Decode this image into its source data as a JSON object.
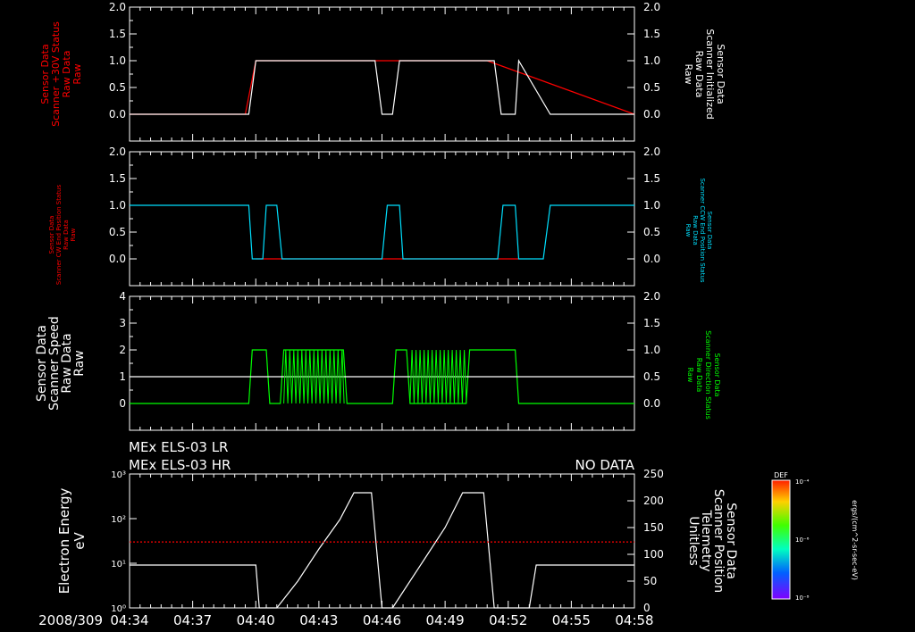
{
  "header": {
    "line1": "MEx ELS-03 LR",
    "line2": "MEx ELS-03 HR",
    "status": "NO DATA"
  },
  "colors": {
    "background": "#000000",
    "axes": "#ffffff",
    "red": "#ff0000",
    "cyan": "#00e0ff",
    "green": "#00ff00"
  },
  "x_axis": {
    "date_prefix": "2008/309",
    "tick_labels": [
      "04:34",
      "04:37",
      "04:40",
      "04:43",
      "04:46",
      "04:49",
      "04:52",
      "04:55",
      "04:58"
    ]
  },
  "colorbar": {
    "top_label": "DEF",
    "tick_top": "10⁻⁴",
    "tick_mid": "10⁻⁶",
    "tick_bottom": "10⁻⁸",
    "units": "ergs/(cm^2-sr-sec-eV)"
  },
  "chart_data": [
    {
      "type": "line",
      "panel": "scanner-status",
      "left_label": [
        "Sensor Data",
        "Scanner +30V Status",
        "Raw Data",
        "Raw"
      ],
      "right_label": [
        "Sensor Data",
        "Scanner Initialized",
        "Raw Data",
        "Raw"
      ],
      "left_ylim": [
        -0.5,
        2.0
      ],
      "left_ticks": [
        "2.0",
        "1.5",
        "1.0",
        "0.5",
        "0.0"
      ],
      "right_ylim": [
        -0.5,
        2.0
      ],
      "right_ticks": [
        "2.0",
        "1.5",
        "1.0",
        "0.5",
        "0.0"
      ],
      "xlim": [
        "04:34",
        "04:58"
      ],
      "series": [
        {
          "name": "Scanner +30V Status",
          "color": "red",
          "x": [
            "04:34",
            "04:39:30",
            "04:40",
            "04:46",
            "04:46:20",
            "04:50:30",
            "04:51",
            "04:58"
          ],
          "values": [
            0,
            0,
            1,
            1,
            1,
            1,
            1,
            0
          ]
        },
        {
          "name": "Scanner Initialized",
          "color": "white",
          "x": [
            "04:34",
            "04:39:40",
            "04:40",
            "04:45:40",
            "04:46",
            "04:46:30",
            "04:46:50",
            "04:51:20",
            "04:51:40",
            "04:52:20",
            "04:52:30",
            "04:54",
            "04:58"
          ],
          "values": [
            0,
            0,
            1,
            1,
            0,
            0,
            1,
            1,
            0,
            0,
            1,
            0,
            0
          ]
        }
      ]
    },
    {
      "type": "line",
      "panel": "scanner-position",
      "left_label": [
        "Sensor Data",
        "Scanner CW End Position Status",
        "Raw Data",
        "Raw"
      ],
      "right_label": [
        "Sensor Data",
        "Scanner CCW End Position Status",
        "Raw Data",
        "Raw"
      ],
      "left_ylim": [
        -0.5,
        2.0
      ],
      "left_ticks": [
        "2.0",
        "1.5",
        "1.0",
        "0.5",
        "0.0"
      ],
      "right_ylim": [
        -0.5,
        2.0
      ],
      "right_ticks": [
        "2.0",
        "1.5",
        "1.0",
        "0.5",
        "0.0"
      ],
      "xlim": [
        "04:34",
        "04:58"
      ],
      "series": [
        {
          "name": "Scanner CW End Position Status",
          "color": "red",
          "x": [
            "04:40",
            "04:41",
            "04:46",
            "04:46:30",
            "04:52",
            "04:52:30"
          ],
          "values": [
            0,
            0,
            0,
            0,
            0,
            0
          ]
        },
        {
          "name": "Scanner CCW End Position Status",
          "color": "cyan",
          "x": [
            "04:34",
            "04:39:40",
            "04:39:50",
            "04:40:20",
            "04:40:30",
            "04:41",
            "04:41:15",
            "04:46",
            "04:46:15",
            "04:46:50",
            "04:47",
            "04:51:30",
            "04:51:45",
            "04:52:20",
            "04:52:30",
            "04:53:40",
            "04:54",
            "04:58"
          ],
          "values": [
            1,
            1,
            0,
            0,
            1,
            1,
            0,
            0,
            1,
            1,
            0,
            0,
            1,
            1,
            0,
            0,
            1,
            1
          ]
        }
      ]
    },
    {
      "type": "line",
      "panel": "scanner-speed",
      "left_label": [
        "Sensor Data",
        "Scanner Speed",
        "Raw Data",
        "Raw"
      ],
      "right_label": [
        "Sensor Data",
        "Scanner Direction Status",
        "Raw Data",
        "Raw"
      ],
      "left_ylim": [
        -1,
        4
      ],
      "left_ticks": [
        "4",
        "3",
        "2",
        "1",
        "0"
      ],
      "right_ylim": [
        -0.5,
        2.0
      ],
      "right_ticks": [
        "2.0",
        "1.5",
        "1.0",
        "0.5",
        "0.0"
      ],
      "xlim": [
        "04:34",
        "04:58"
      ],
      "series": [
        {
          "name": "Scanner Speed",
          "color": "green",
          "x": [
            "04:34",
            "04:39:40",
            "04:39:50",
            "04:40:30",
            "04:40:40",
            "04:41:10",
            "04:41:20",
            "04:44:10",
            "04:44:20",
            "04:46:30",
            "04:46:40",
            "04:47:10",
            "04:47:20",
            "04:50",
            "04:50:10",
            "04:52:20",
            "04:52:30",
            "04:58"
          ],
          "values": [
            0,
            0,
            2,
            2,
            0,
            0,
            2,
            2,
            0,
            0,
            2,
            2,
            0,
            0,
            2,
            2,
            0,
            0
          ]
        },
        {
          "name": "Scanner Direction Status",
          "color": "white",
          "x": [
            "04:34",
            "04:58"
          ],
          "values": [
            0.5,
            0.5
          ]
        }
      ]
    },
    {
      "type": "line",
      "panel": "electron-energy",
      "left_label": [
        "Electron Energy",
        "eV"
      ],
      "right_label": [
        "Sensor Data",
        "Scanner Position",
        "Telemetry",
        "Unitless"
      ],
      "left_ylim": [
        1,
        1000
      ],
      "left_scale": "log",
      "left_ticks": [
        "10³",
        "10²",
        "10¹",
        "10⁰"
      ],
      "right_ylim": [
        0,
        250
      ],
      "right_ticks": [
        "250",
        "200",
        "150",
        "100",
        "50",
        "0"
      ],
      "xlim": [
        "04:34",
        "04:58"
      ],
      "series": [
        {
          "name": "Scanner Position",
          "color": "white",
          "x": [
            "04:34",
            "04:40",
            "04:40:10",
            "04:41",
            "04:42",
            "04:43",
            "04:44",
            "04:44:40",
            "04:45:30",
            "04:46",
            "04:46:30",
            "04:47",
            "04:48",
            "04:49",
            "04:49:50",
            "04:50:50",
            "04:51:20",
            "04:52",
            "04:53",
            "04:53:20",
            "04:58"
          ],
          "values": [
            80,
            80,
            0,
            0,
            50,
            110,
            165,
            215,
            215,
            0,
            0,
            30,
            90,
            150,
            215,
            215,
            0,
            0,
            0,
            80,
            80
          ]
        },
        {
          "name": "Electron Energy",
          "color": "dashed",
          "x": [
            "04:34",
            "04:39:40",
            "04:40:20",
            "04:44:20",
            "04:46:20",
            "04:50:20",
            "04:53:20",
            "04:58"
          ],
          "values": [
            30,
            30,
            30,
            30,
            30,
            30,
            30,
            30
          ]
        }
      ]
    }
  ]
}
